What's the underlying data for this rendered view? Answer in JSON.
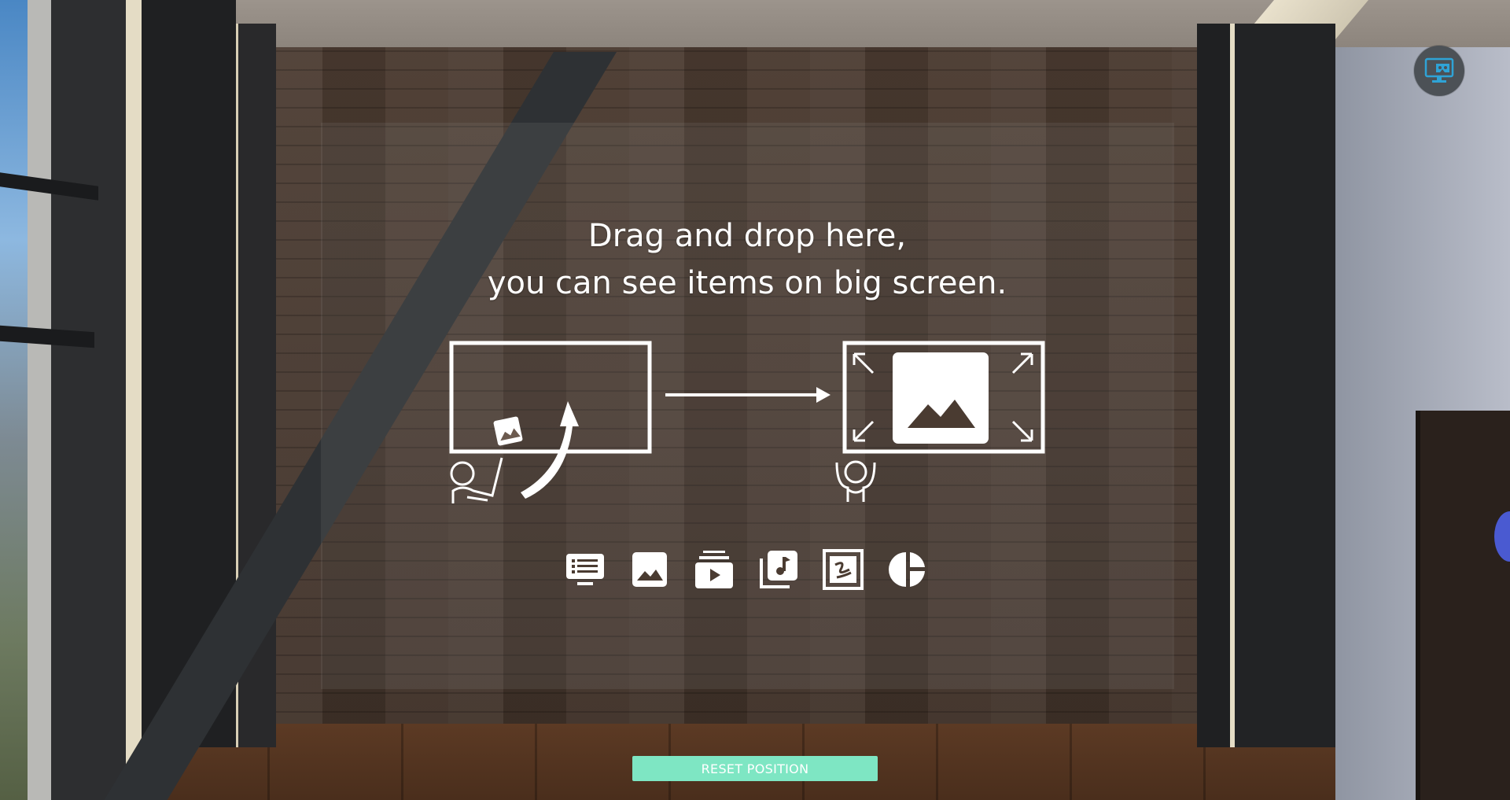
{
  "instructions": {
    "line1": "Drag and drop here,",
    "line2": "you can see items on big screen."
  },
  "toolbar": {
    "icons": [
      "board-icon",
      "image-icon",
      "video-playlist-icon",
      "music-icon",
      "drawing-board-icon",
      "pie-chart-icon"
    ]
  },
  "vr_button": {
    "icon": "vr-headset-monitor-icon",
    "accent": "#2fa3d6"
  },
  "reset_button": {
    "label": "RESET POSITION",
    "color": "#7ee6c3"
  }
}
